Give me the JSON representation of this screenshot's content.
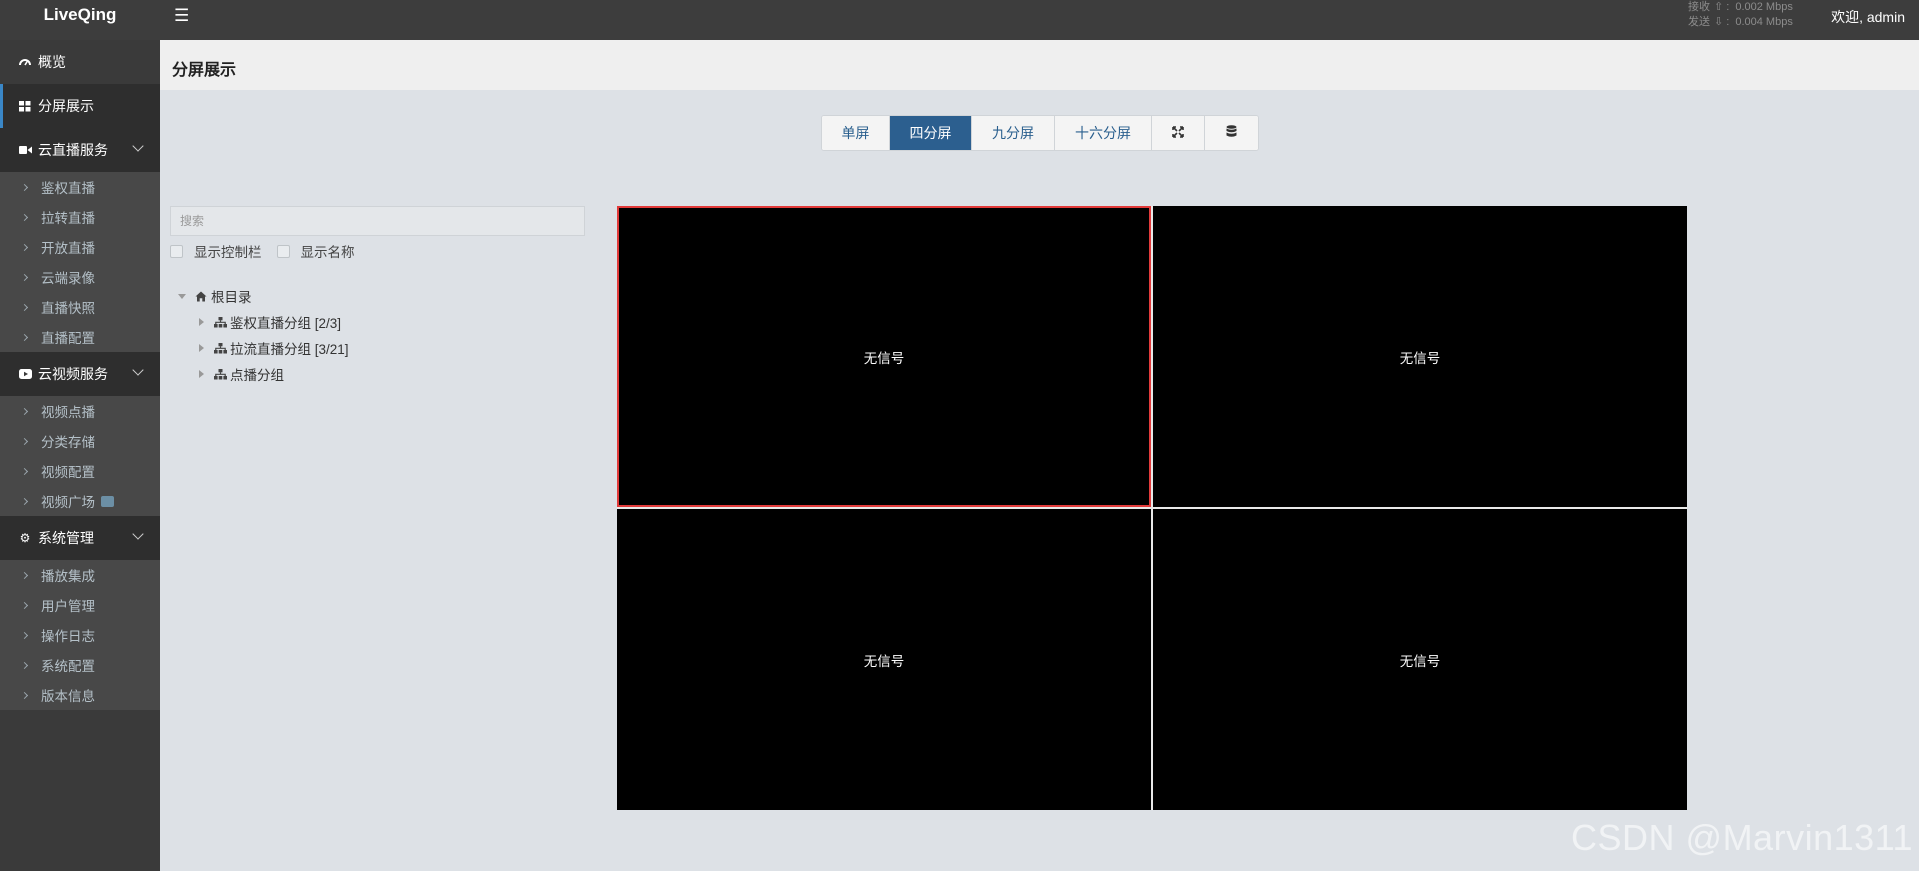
{
  "app": {
    "brand": "LiveQing",
    "welcome": "欢迎, admin"
  },
  "network": {
    "recv_label": "接收",
    "recv_value": "0.002 Mbps",
    "send_label": "发送",
    "send_value": "0.004 Mbps"
  },
  "sidebar": {
    "overview": "概览",
    "split": "分屏展示",
    "live_group": "云直播服务",
    "live_items": [
      "鉴权直播",
      "拉转直播",
      "开放直播",
      "云端录像",
      "直播快照",
      "直播配置"
    ],
    "video_group": "云视频服务",
    "video_items": [
      "视频点播",
      "分类存储",
      "视频配置",
      "视频广场"
    ],
    "sys_group": "系统管理",
    "sys_items": [
      "播放集成",
      "用户管理",
      "操作日志",
      "系统配置",
      "版本信息"
    ]
  },
  "page": {
    "title": "分屏展示"
  },
  "layout_buttons": {
    "single": "单屏",
    "four": "四分屏",
    "nine": "九分屏",
    "sixteen": "十六分屏",
    "selected": "四分屏"
  },
  "search": {
    "placeholder": "搜索"
  },
  "options": {
    "show_controls": "显示控制栏",
    "show_names": "显示名称"
  },
  "tree": {
    "root": "根目录",
    "children": [
      "鉴权直播分组 [2/3]",
      "拉流直播分组 [3/21]",
      "点播分组"
    ]
  },
  "players": [
    "无信号",
    "无信号",
    "无信号",
    "无信号"
  ],
  "watermark": "CSDN @Marvin1311",
  "colors": {
    "accent": "#2c5f8f",
    "selected_border": "#e23a3a",
    "sidebar": "#3a3a3a"
  }
}
